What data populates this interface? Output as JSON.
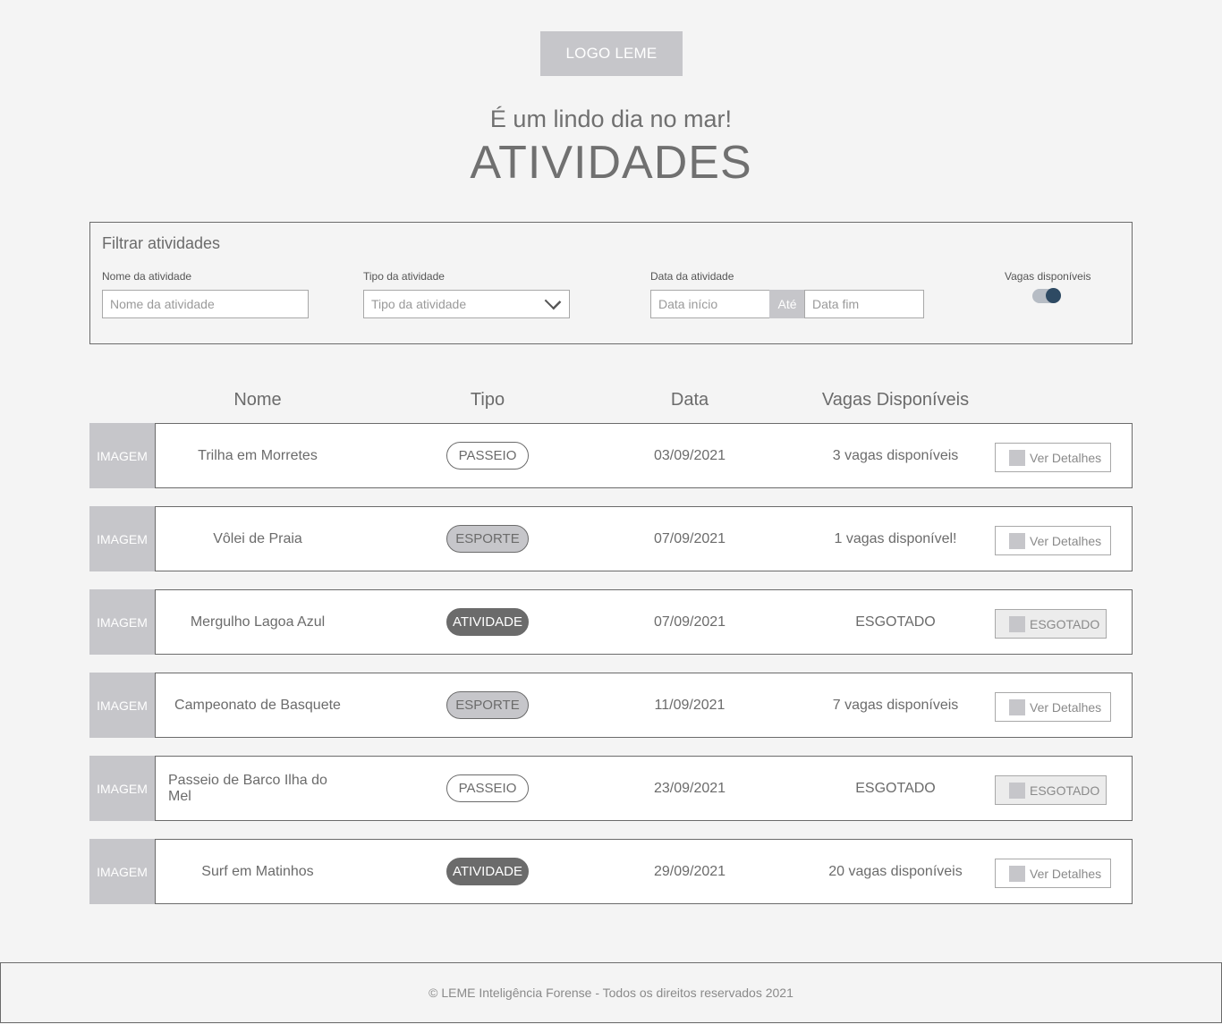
{
  "logo": {
    "label": "LOGO LEME"
  },
  "header": {
    "greeting": "É um lindo dia no mar!",
    "title": "ATIVIDADES"
  },
  "filters": {
    "title": "Filtrar atividades",
    "name": {
      "label": "Nome da atividade",
      "placeholder": "Nome da atividade"
    },
    "type": {
      "label": "Tipo da atividade",
      "placeholder": "Tipo da atividade"
    },
    "date": {
      "label": "Data da atividade",
      "start_placeholder": "Data início",
      "separator": "Até",
      "end_placeholder": "Data fim"
    },
    "vacancies": {
      "label": "Vagas disponíveis",
      "toggle_on": true
    }
  },
  "table": {
    "headers": {
      "name": "Nome",
      "type": "Tipo",
      "date": "Data",
      "vacancies": "Vagas Disponíveis"
    },
    "image_label": "IMAGEM",
    "rows": [
      {
        "name": "Trilha em Morretes",
        "type": "PASSEIO",
        "type_style": "passeio",
        "date": "03/09/2021",
        "vacancies": "3 vagas disponíveis",
        "button": "Ver Detalhes",
        "sold_out": false
      },
      {
        "name": "Vôlei de Praia",
        "type": "ESPORTE",
        "type_style": "esporte",
        "date": "07/09/2021",
        "vacancies": "1 vagas disponível!",
        "button": "Ver Detalhes",
        "sold_out": false
      },
      {
        "name": "Mergulho Lagoa Azul",
        "type": "ATIVIDADE",
        "type_style": "atividade",
        "date": "07/09/2021",
        "vacancies": "ESGOTADO",
        "button": "ESGOTADO",
        "sold_out": true
      },
      {
        "name": "Campeonato de Basquete",
        "type": "ESPORTE",
        "type_style": "esporte",
        "date": "11/09/2021",
        "vacancies": "7 vagas disponíveis",
        "button": "Ver Detalhes",
        "sold_out": false
      },
      {
        "name": "Passeio de Barco Ilha do Mel",
        "type": "PASSEIO",
        "type_style": "passeio",
        "date": "23/09/2021",
        "vacancies": "ESGOTADO",
        "button": "ESGOTADO",
        "sold_out": true
      },
      {
        "name": "Surf em Matinhos",
        "type": "ATIVIDADE",
        "type_style": "atividade",
        "date": "29/09/2021",
        "vacancies": "20 vagas disponíveis",
        "button": "Ver Detalhes",
        "sold_out": false
      }
    ]
  },
  "footer": {
    "text": "© LEME Inteligência Forense - Todos os direitos reservados 2021"
  },
  "colors": {
    "background": "#f4f4f4",
    "placeholder_gray": "#c6c6ca",
    "text": "#6b6b6b",
    "toggle_knob": "#2e4a63"
  },
  "icons": {
    "select": "chevron-down-icon"
  }
}
